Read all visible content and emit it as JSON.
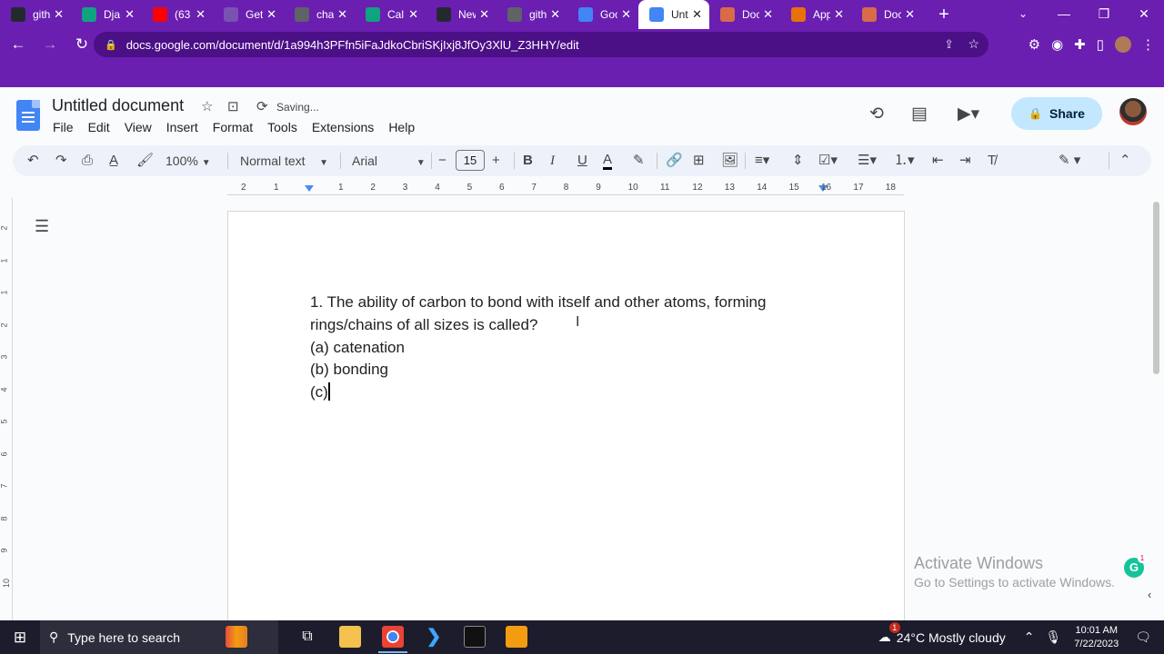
{
  "browser": {
    "tabs": [
      {
        "title": "gith",
        "fav": "github",
        "favcolor": "#24292f"
      },
      {
        "title": "Dja",
        "fav": "chatgpt",
        "favcolor": "#10a37f"
      },
      {
        "title": "(63",
        "fav": "youtube",
        "favcolor": "#ff0000"
      },
      {
        "title": "Get",
        "fav": "bootstrap",
        "favcolor": "#7952b3"
      },
      {
        "title": "cha",
        "fav": "globe",
        "favcolor": "#5f6368"
      },
      {
        "title": "Cal",
        "fav": "chatgpt",
        "favcolor": "#10a37f"
      },
      {
        "title": "New",
        "fav": "github",
        "favcolor": "#24292f"
      },
      {
        "title": "gith",
        "fav": "globe",
        "favcolor": "#5f6368"
      },
      {
        "title": "Goo",
        "fav": "docs",
        "favcolor": "#4285f4"
      },
      {
        "title": "Unt",
        "fav": "docs",
        "favcolor": "#4285f4",
        "active": true
      },
      {
        "title": "Doc",
        "fav": "docs-photo",
        "favcolor": "#d86b4a"
      },
      {
        "title": "App",
        "fav": "apps",
        "favcolor": "#e8710a"
      },
      {
        "title": "Doc",
        "fav": "docs-photo",
        "favcolor": "#d86b4a"
      }
    ],
    "url": "docs.google.com/document/d/1a994h3PFfn5iFaJdkoCbriSKjIxj8JfOy3XlU_Z3HHY/edit"
  },
  "docs": {
    "title": "Untitled document",
    "status": "Saving...",
    "menu": [
      "File",
      "Edit",
      "View",
      "Insert",
      "Format",
      "Tools",
      "Extensions",
      "Help"
    ],
    "share_label": "Share",
    "toolbar": {
      "zoom": "100%",
      "style": "Normal text",
      "font": "Arial",
      "font_size": "15"
    },
    "ruler_numbers": [
      "2",
      "1",
      "1",
      "2",
      "3",
      "4",
      "5",
      "6",
      "7",
      "8",
      "9",
      "10",
      "11",
      "12",
      "13",
      "14",
      "15",
      "16",
      "17",
      "18"
    ],
    "vruler_numbers": [
      "2",
      "1",
      "1",
      "2",
      "3",
      "4",
      "5",
      "6",
      "7",
      "8",
      "9",
      "10"
    ],
    "content": {
      "question_line1": "1. The ability of carbon to bond with itself and other atoms, forming",
      "question_line2": "rings/chains of all sizes is called?",
      "option_a": "(a) catenation",
      "option_b": "(b) bonding",
      "option_c": "(c)"
    }
  },
  "watermark": {
    "line1": "Activate Windows",
    "line2": "Go to Settings to activate Windows."
  },
  "grammarly_count": "1",
  "taskbar": {
    "search_placeholder": "Type here to search",
    "weather": "24°C  Mostly cloudy",
    "weather_badge": "1",
    "time": "10:01 AM",
    "date": "7/22/2023"
  }
}
